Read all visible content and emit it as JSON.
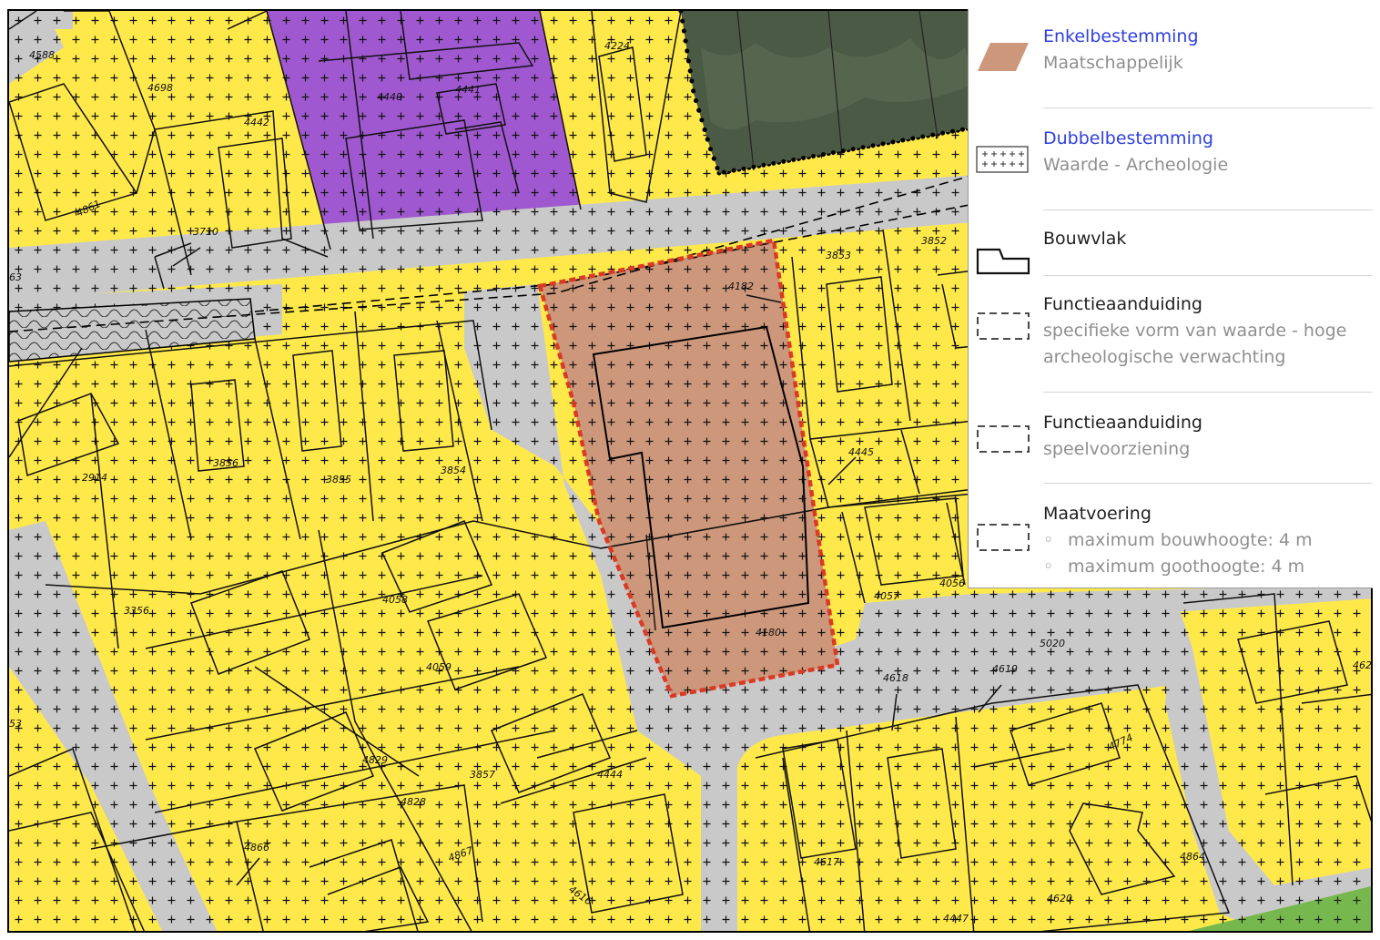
{
  "map": {
    "colors": {
      "residential": "#ffe94a",
      "road": "#c9c9c9",
      "purple": "#9f58cf",
      "highlight_fill": "#cd977b",
      "highlight_border": "#d93a23",
      "green": "#76b84e",
      "forest": "#4b5a44"
    },
    "parcel_labels": [
      {
        "id": "l4588",
        "text": "4588"
      },
      {
        "id": "l4698",
        "text": "4698"
      },
      {
        "id": "l4442",
        "text": "4442"
      },
      {
        "id": "l4440",
        "text": "4440"
      },
      {
        "id": "l4441",
        "text": "4441"
      },
      {
        "id": "l4224",
        "text": "4224"
      },
      {
        "id": "l4861",
        "text": "4861"
      },
      {
        "id": "l3710",
        "text": "3710"
      },
      {
        "id": "l63",
        "text": "63"
      },
      {
        "id": "l3853",
        "text": "3853"
      },
      {
        "id": "l3852",
        "text": "3852"
      },
      {
        "id": "l4182",
        "text": "4182"
      },
      {
        "id": "l3856",
        "text": "3856"
      },
      {
        "id": "l2914",
        "text": "2914"
      },
      {
        "id": "l3855",
        "text": "3855"
      },
      {
        "id": "l3854",
        "text": "3854"
      },
      {
        "id": "l4445",
        "text": "4445"
      },
      {
        "id": "l4058",
        "text": "4058"
      },
      {
        "id": "l3356",
        "text": "3356"
      },
      {
        "id": "l4059",
        "text": "4059"
      },
      {
        "id": "l4057",
        "text": "4057"
      },
      {
        "id": "l4056",
        "text": "4056"
      },
      {
        "id": "l4180",
        "text": "4180"
      },
      {
        "id": "l5020",
        "text": "5020"
      },
      {
        "id": "l4618",
        "text": "4618"
      },
      {
        "id": "l4619",
        "text": "4619"
      },
      {
        "id": "l462",
        "text": "462"
      },
      {
        "id": "l53",
        "text": "53"
      },
      {
        "id": "l4829",
        "text": "4829"
      },
      {
        "id": "l3857",
        "text": "3857"
      },
      {
        "id": "l4444",
        "text": "4444"
      },
      {
        "id": "l4774",
        "text": "4774"
      },
      {
        "id": "l4828",
        "text": "4828"
      },
      {
        "id": "l4866",
        "text": "4866"
      },
      {
        "id": "l4867",
        "text": "4867"
      },
      {
        "id": "l4617",
        "text": "4617"
      },
      {
        "id": "l4616",
        "text": "4616"
      },
      {
        "id": "l4864",
        "text": "4864"
      },
      {
        "id": "l4620",
        "text": "4620"
      },
      {
        "id": "l4447",
        "text": "4447"
      }
    ]
  },
  "legend": {
    "items": [
      {
        "title": "Enkelbestemming",
        "subtitle": "Maatschappelijk",
        "symbol": "brown-parallelogram"
      },
      {
        "title": "Dubbelbestemming",
        "subtitle": "Waarde - Archeologie",
        "symbol": "plus-pattern-box"
      },
      {
        "title": "Bouwvlak",
        "symbol": "building-outline"
      },
      {
        "title": "Functieaanduiding",
        "subtitle_lines": [
          "specifieke vorm van waarde - hoge",
          "archeologische verwachting"
        ],
        "symbol": "dashed-box"
      },
      {
        "title": "Functieaanduiding",
        "subtitle": "speelvoorziening",
        "symbol": "dashed-box"
      },
      {
        "title": "Maatvoering",
        "bullets": [
          "maximum bouwhoogte: 4 m",
          "maximum goothoogte: 4 m"
        ],
        "bullet_glyph": "◦",
        "symbol": "dashed-box"
      }
    ]
  }
}
